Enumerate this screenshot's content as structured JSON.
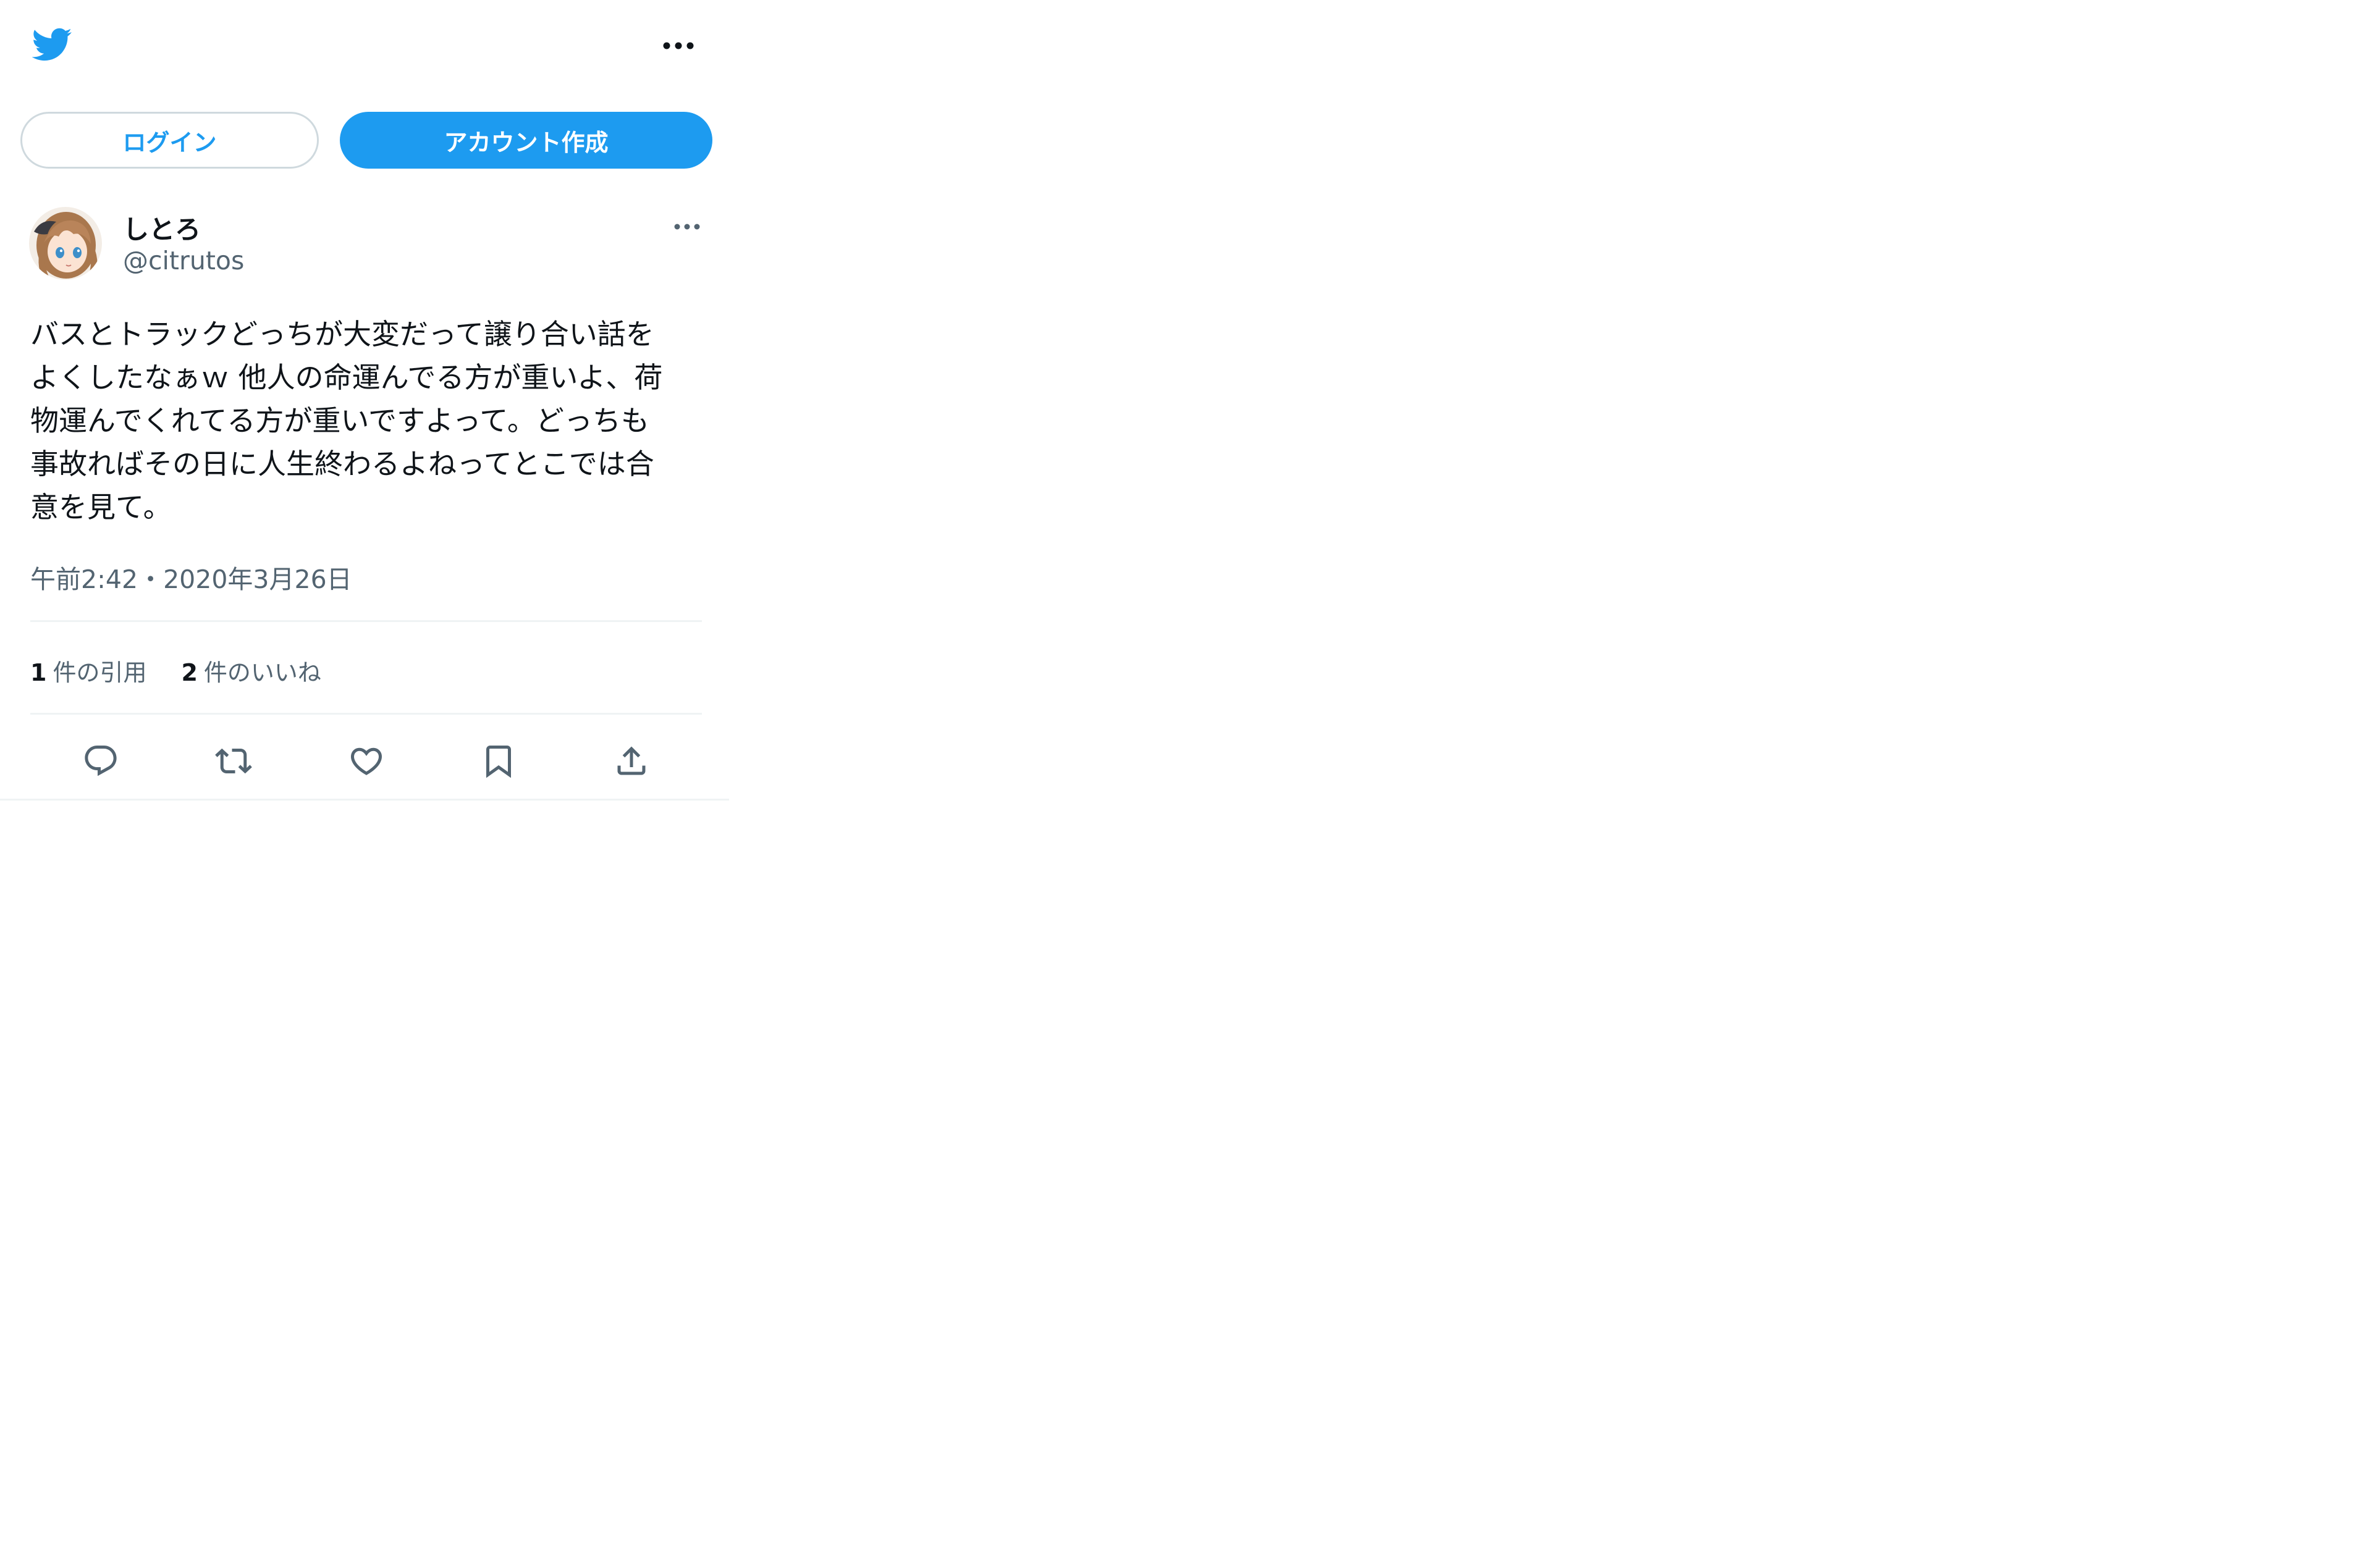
{
  "header": {
    "logo_icon": "twitter-bird-icon",
    "more_icon": "more-horizontal-icon"
  },
  "auth": {
    "login_label": "ログイン",
    "signup_label": "アカウント作成"
  },
  "tweet": {
    "author": {
      "display_name": "しとろ",
      "handle": "@citrutos",
      "avatar_icon": "user-avatar"
    },
    "text_lines": [
      "バスとトラックどっちが大変だって譲り合い話を",
      "よくしたなぁｗ 他人の命運んでる方が重いよ、荷",
      "物運んでくれてる方が重いですよって。どっちも",
      "事故ればその日に人生終わるよねってとこでは合",
      "意を見て。"
    ],
    "timestamp": "午前2:42・2020年3月26日",
    "stats": {
      "quotes_count": "1",
      "quotes_label": "件の引用",
      "likes_count": "2",
      "likes_label": "件のいいね"
    },
    "actions": [
      "reply-icon",
      "retweet-icon",
      "like-icon",
      "bookmark-icon",
      "share-icon"
    ]
  },
  "colors": {
    "accent": "#1d9bf0",
    "text_primary": "#0f1419",
    "text_secondary": "#536471",
    "divider": "#eff3f4",
    "icon": "#536471"
  }
}
